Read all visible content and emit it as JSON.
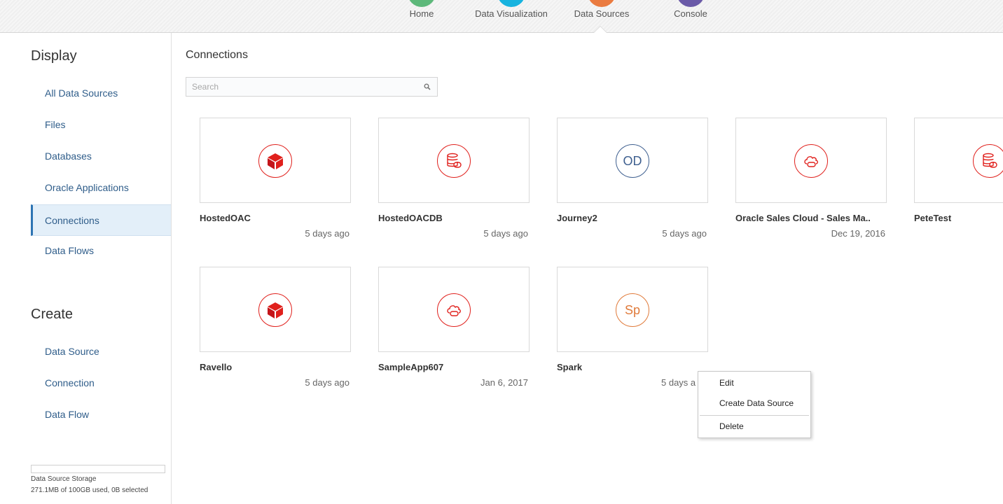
{
  "topnav": {
    "items": [
      {
        "label": "Home",
        "color": "#5db87a"
      },
      {
        "label": "Data Visualization",
        "color": "#17b3df"
      },
      {
        "label": "Data Sources",
        "color": "#ea7b40"
      },
      {
        "label": "Console",
        "color": "#6a5aa8"
      }
    ],
    "active": "Data Sources"
  },
  "sidebar": {
    "display_heading": "Display",
    "display_items": [
      {
        "label": "All Data Sources"
      },
      {
        "label": "Files"
      },
      {
        "label": "Databases"
      },
      {
        "label": "Oracle Applications"
      },
      {
        "label": "Connections",
        "active": true
      },
      {
        "label": "Data Flows"
      }
    ],
    "create_heading": "Create",
    "create_items": [
      {
        "label": "Data Source"
      },
      {
        "label": "Connection"
      },
      {
        "label": "Data Flow"
      }
    ],
    "storage_title": "Data Source Storage",
    "storage_usage": "271.1MB of 100GB used, 0B selected"
  },
  "main": {
    "title": "Connections",
    "search_placeholder": "Search",
    "cards": [
      {
        "name": "HostedOAC",
        "date": "5 days ago",
        "icon": "cube-icon"
      },
      {
        "name": "HostedOACDB",
        "date": "5 days ago",
        "icon": "database-icon"
      },
      {
        "name": "Journey2",
        "date": "5 days ago",
        "icon": "initials-icon",
        "initials": "OD"
      },
      {
        "name": "Oracle Sales Cloud - Sales Ma..",
        "date": "Dec 19, 2016",
        "icon": "cloud-icon"
      },
      {
        "name": "PeteTest",
        "date": "",
        "icon": "database-icon"
      },
      {
        "name": "Ravello",
        "date": "5 days ago",
        "icon": "cube-icon"
      },
      {
        "name": "SampleApp607",
        "date": "Jan 6, 2017",
        "icon": "cloud-icon"
      },
      {
        "name": "Spark",
        "date": "5 days a",
        "icon": "initials-icon",
        "initials": "Sp"
      }
    ]
  },
  "context_menu": {
    "items": [
      "Edit",
      "Create Data Source",
      "Delete"
    ]
  },
  "colors": {
    "accent_red": "#e0201c",
    "link_blue": "#2f5d8a",
    "active_bg": "#e3eff9",
    "od_blue": "#3e5f8f",
    "sp_orange": "#e07a3a"
  }
}
